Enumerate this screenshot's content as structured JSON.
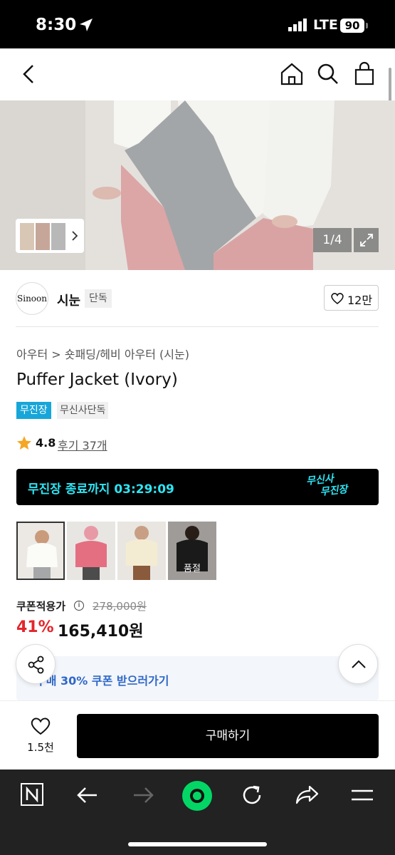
{
  "status": {
    "time": "8:30",
    "network": "LTE",
    "battery": "90"
  },
  "gallery": {
    "counter": "1/4"
  },
  "brand": {
    "logo_text": "Sinoon",
    "name": "시눈",
    "badge": "단독",
    "like_count": "12만"
  },
  "product": {
    "breadcrumb": "아우터 > 숏패딩/헤비 아우터 (시눈)",
    "title": "Puffer Jacket (Ivory)",
    "tags": [
      "무진장",
      "무신사단독"
    ],
    "rating": "4.8",
    "reviews": "후기 37개"
  },
  "banner": {
    "text": "무진장 종료까지 03:29:09",
    "logo_line1": "무신사",
    "logo_line2": "무진장",
    "color": "#2ce6f5"
  },
  "colors": [
    {
      "selected": true,
      "soldout_label": ""
    },
    {
      "selected": false,
      "soldout_label": ""
    },
    {
      "selected": false,
      "soldout_label": ""
    },
    {
      "selected": false,
      "soldout_label": "품절"
    }
  ],
  "price": {
    "label": "쿠폰적용가",
    "info_icon": "i",
    "original": "278,000원",
    "discount": "41%",
    "sale": "165,410원",
    "discount_color": "#e3262c"
  },
  "coupon": {
    "text": "구매 30% 쿠폰 받으러가기"
  },
  "bottom": {
    "wish_count": "1.5천",
    "buy_label": "구매하기"
  },
  "icons": {
    "status": [
      "location-arrow-icon",
      "signal-icon"
    ],
    "nav": [
      "back-icon",
      "home-icon",
      "search-icon",
      "cart-icon"
    ],
    "browser": [
      "naver-n-icon",
      "back-arrow-icon",
      "forward-arrow-icon",
      "home-green-icon",
      "refresh-icon",
      "share-icon",
      "menu-icon"
    ]
  }
}
